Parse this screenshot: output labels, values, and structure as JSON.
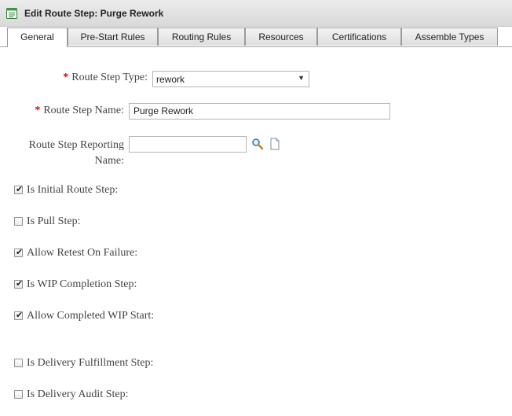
{
  "window": {
    "title": "Edit Route Step: Purge Rework",
    "icon": "form-icon"
  },
  "tabs": [
    {
      "label": "General",
      "active": true
    },
    {
      "label": "Pre-Start Rules",
      "active": false
    },
    {
      "label": "Routing Rules",
      "active": false
    },
    {
      "label": "Resources",
      "active": false
    },
    {
      "label": "Certifications",
      "active": false
    },
    {
      "label": "Assemble Types",
      "active": false
    }
  ],
  "form": {
    "required_marker": "*",
    "route_step_type": {
      "label": "Route Step Type:",
      "value": "rework"
    },
    "route_step_name": {
      "label": "Route Step Name:",
      "value": "Purge Rework"
    },
    "reporting_name": {
      "label_line1": "Route Step Reporting",
      "label_line2": "Name:",
      "value": ""
    },
    "checkboxes": [
      {
        "label": "Is Initial Route Step:",
        "checked": true
      },
      {
        "label": "Is Pull Step:",
        "checked": false
      },
      {
        "label": "Allow Retest On Failure:",
        "checked": true
      },
      {
        "label": "Is WIP Completion Step:",
        "checked": true
      },
      {
        "label": "Allow Completed WIP Start:",
        "checked": true
      },
      {
        "label": "Is Delivery Fulfillment Step:",
        "checked": false
      },
      {
        "label": "Is Delivery Audit Step:",
        "checked": false
      }
    ],
    "tick_glyph": "✔"
  }
}
